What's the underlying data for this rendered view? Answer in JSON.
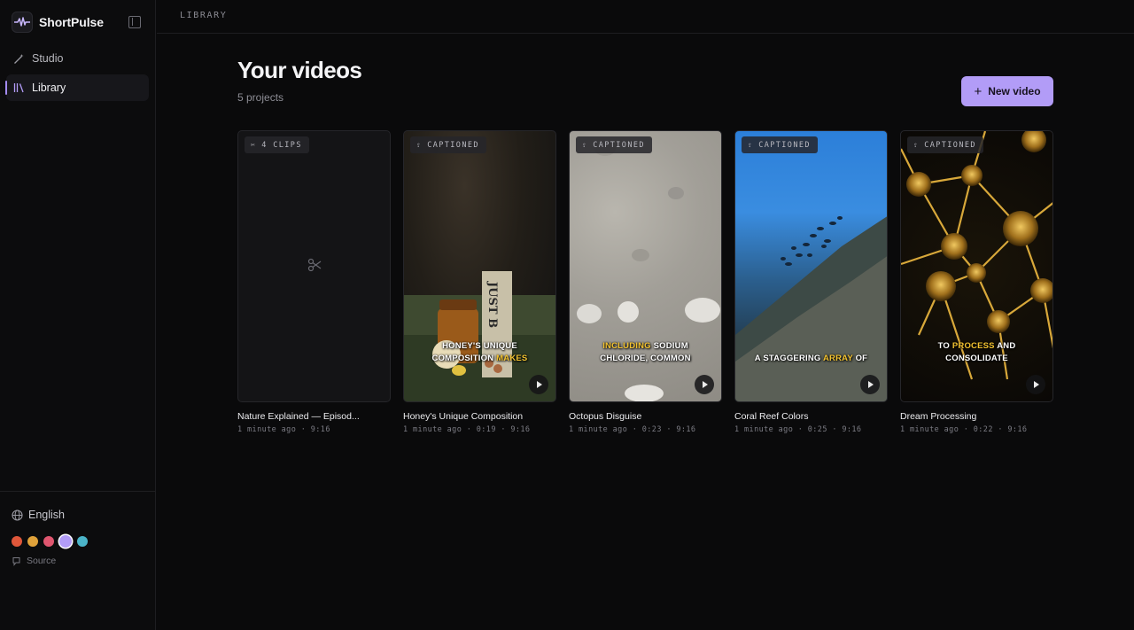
{
  "app": {
    "name": "ShortPulse"
  },
  "sidebar": {
    "nav": [
      {
        "label": "Studio",
        "icon": "magic-wand-icon"
      },
      {
        "label": "Library",
        "icon": "library-icon",
        "active": true
      }
    ],
    "language": "English",
    "themes": [
      "#e0573a",
      "#e0a23a",
      "#e0566f",
      "#b29cf7",
      "#4bb4c8"
    ],
    "selected_theme": "#b29cf7",
    "source_label": "Source"
  },
  "topbar": {
    "breadcrumb": "LIBRARY"
  },
  "main": {
    "title": "Your videos",
    "subtitle": "5 projects",
    "new_button": "New video",
    "accent": "#b29cf7"
  },
  "videos": [
    {
      "title": "Nature Explained — Episod...",
      "meta": "1 minute ago · 9:16",
      "badge": "4 CLIPS",
      "caption": "",
      "caption_hl": "",
      "caption_rest": ""
    },
    {
      "title": "Honey's Unique Composition",
      "meta": "1 minute ago · 0:19 · 9:16",
      "badge": "CAPTIONED",
      "caption_line1": "HONEY'S UNIQUE",
      "caption_line2_pre": "COMPOSITION ",
      "caption_line2_hl": "MAKES"
    },
    {
      "title": "Octopus Disguise",
      "meta": "1 minute ago · 0:23 · 9:16",
      "badge": "CAPTIONED",
      "caption_line1_hl": "INCLUDING",
      "caption_line1_post": " SODIUM",
      "caption_line2": "CHLORIDE, COMMON"
    },
    {
      "title": "Coral Reef Colors",
      "meta": "1 minute ago · 0:25 · 9:16",
      "badge": "CAPTIONED",
      "caption_pre": "A STAGGERING ",
      "caption_hl": "ARRAY",
      "caption_post": " OF"
    },
    {
      "title": "Dream Processing",
      "meta": "1 minute ago · 0:22 · 9:16",
      "badge": "CAPTIONED",
      "caption_line1_pre": "TO ",
      "caption_line1_hl": "PROCESS",
      "caption_line1_post": " AND",
      "caption_line2": "CONSOLIDATE"
    }
  ]
}
